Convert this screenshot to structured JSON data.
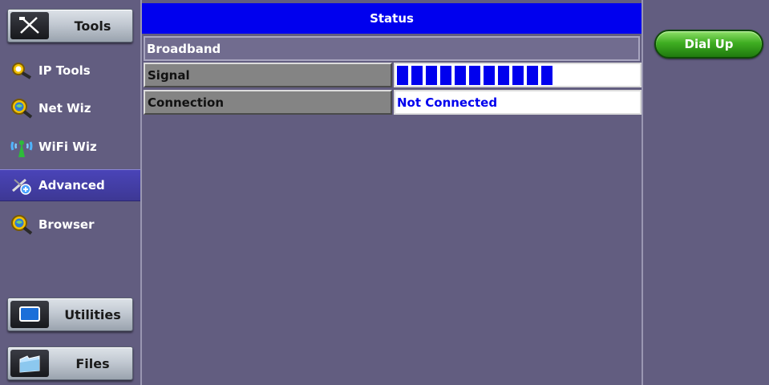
{
  "sidebar": {
    "tools_label": "Tools",
    "items": [
      {
        "label": "IP Tools",
        "icon": "magnifier-icon"
      },
      {
        "label": "Net Wiz",
        "icon": "magnifier-globe-icon"
      },
      {
        "label": "WiFi Wiz",
        "icon": "wifi-antenna-icon"
      },
      {
        "label": "Advanced",
        "icon": "advanced-tool-icon"
      },
      {
        "label": "Browser",
        "icon": "browser-globe-icon"
      }
    ],
    "utilities_label": "Utilities",
    "files_label": "Files"
  },
  "main": {
    "title": "Status",
    "section": "Broadband",
    "rows": [
      {
        "label": "Signal",
        "bars_filled": 11
      },
      {
        "label": "Connection",
        "value": "Not Connected"
      }
    ]
  },
  "right": {
    "dialup_label": "Dial Up"
  },
  "colors": {
    "accent": "#0000ee",
    "background": "#5f5a7e",
    "active_nav": "#4a44b8",
    "dialup_green": "#3fae22"
  }
}
